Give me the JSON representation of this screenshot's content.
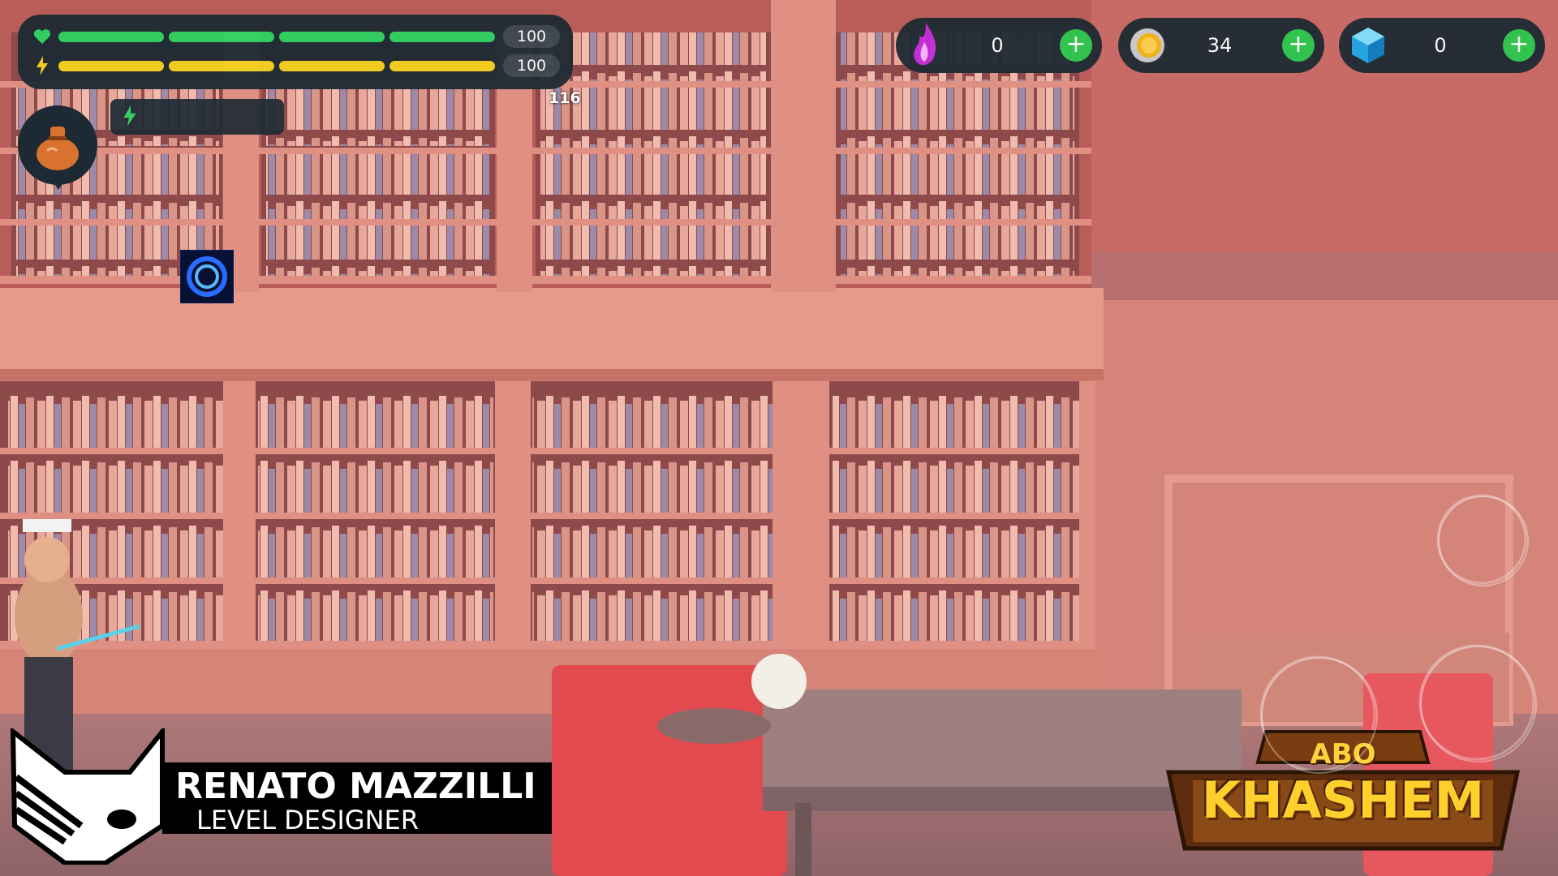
{
  "hud": {
    "health": {
      "icon": "heart-icon",
      "value": "100",
      "fraction": 1.0,
      "color": "#2fd463"
    },
    "energy": {
      "icon": "lightning-icon",
      "value": "100",
      "fraction": 1.0,
      "color": "#f6d21f"
    },
    "xp_label": "116",
    "bag": {
      "icon": "money-bag-icon"
    },
    "energy_panel": {
      "icon": "lightning-icon",
      "color": "#2fd463"
    },
    "ability": {
      "icon": "vortex-portal-icon"
    }
  },
  "currencies": [
    {
      "icon": "purple-flame-icon",
      "value": "0",
      "plus": "+"
    },
    {
      "icon": "gold-coin-icon",
      "value": "34",
      "plus": "+"
    },
    {
      "icon": "blue-gem-icon",
      "value": "0",
      "plus": "+"
    }
  ],
  "credit": {
    "name": "RENATO MAZZILLI",
    "role": "LEVEL DESIGNER",
    "logo": "fox-head-logo"
  },
  "game_logo": {
    "line1": "ABO",
    "line2": "KHASHEM"
  },
  "colors": {
    "accent_green": "#2bc84d",
    "panel": "#1e2a33",
    "room": "#c9706a"
  }
}
